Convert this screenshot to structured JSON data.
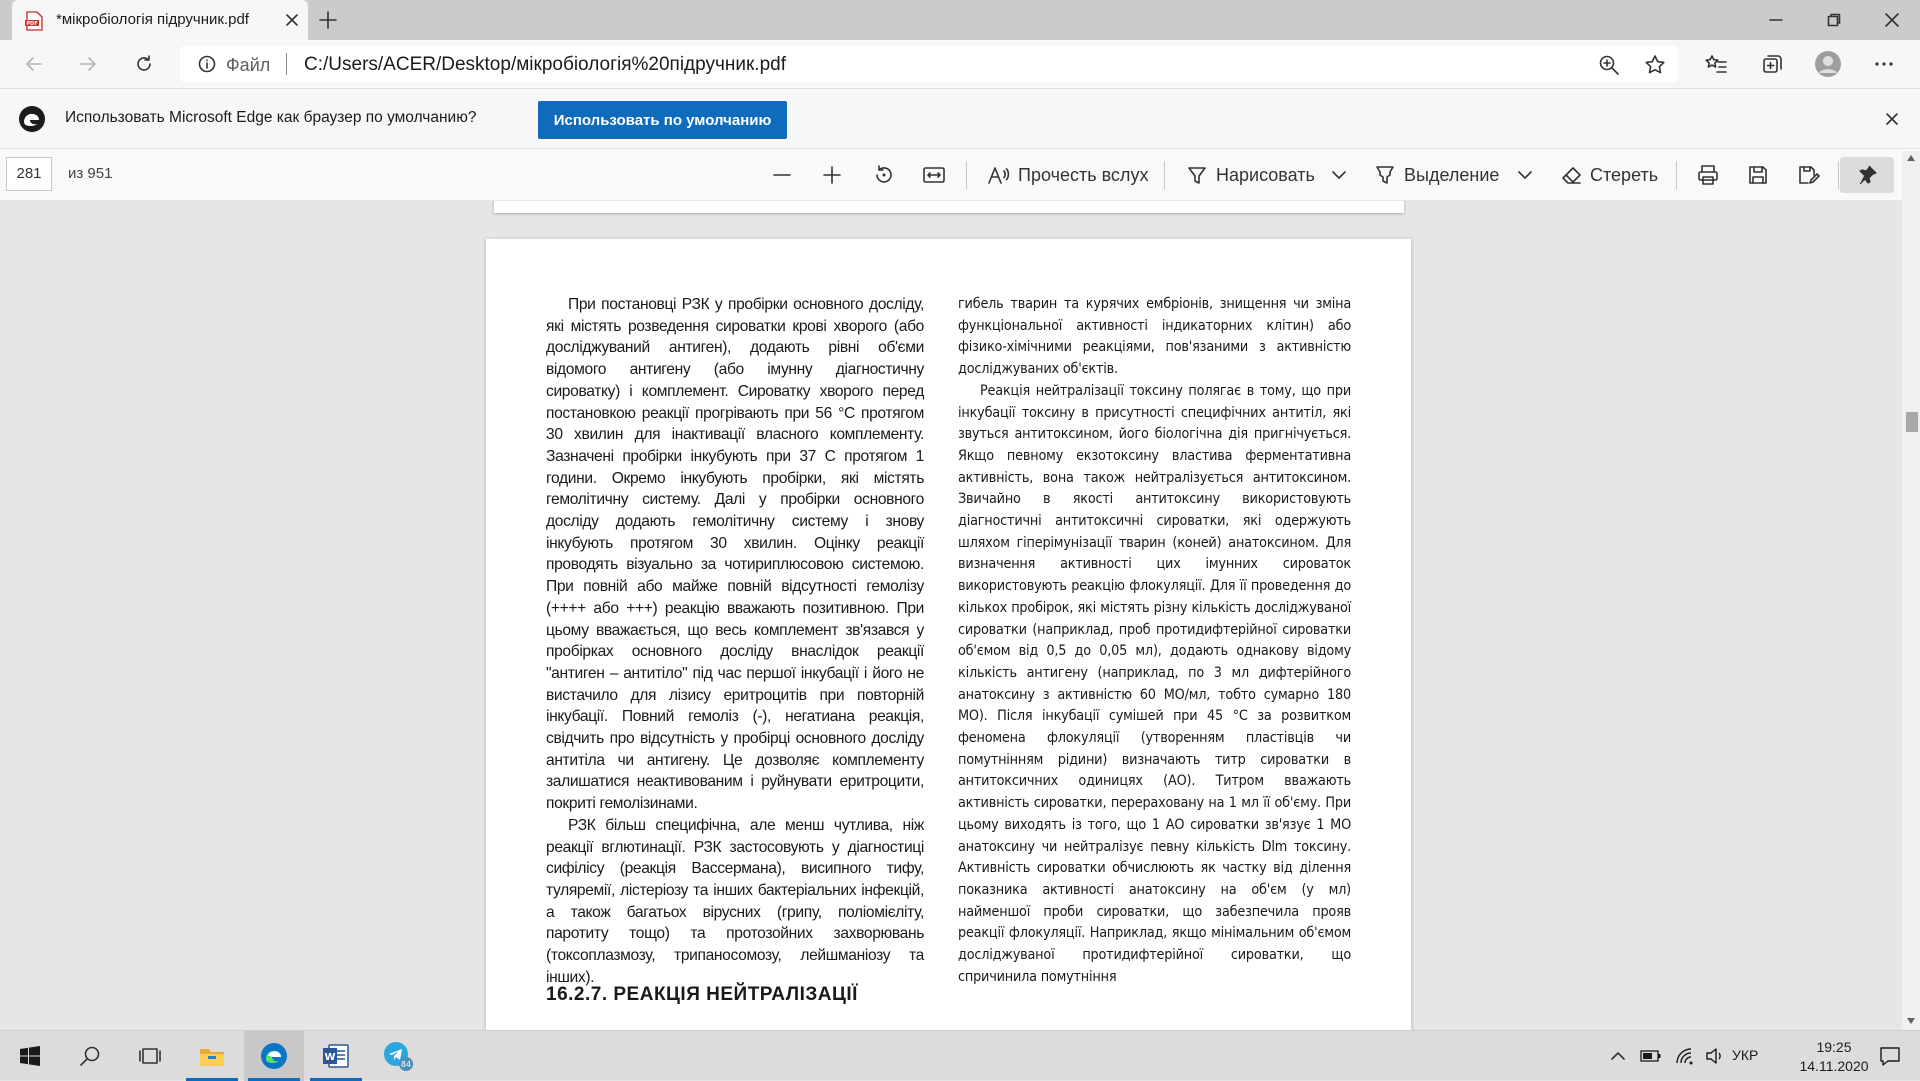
{
  "tab": {
    "title": "*мікробіологія підручник.pdf",
    "icon": "pdf-icon"
  },
  "address": {
    "file_label": "Файл",
    "url": "C:/Users/ACER/Desktop/мікробіологія%20підручник.pdf"
  },
  "infobar": {
    "message": "Использовать Microsoft Edge как браузер по умолчанию?",
    "button_label": "Использовать по умолчанию"
  },
  "pdf_toolbar": {
    "page_number": "281",
    "page_total": "из 951",
    "read_aloud": "Прочесть вслух",
    "draw": "Нарисовать",
    "highlight": "Выделение",
    "erase": "Стереть"
  },
  "document": {
    "left_col": [
      "При постановці РЗК у пробірки основного досліду, які містять розведення сироватки крові хворого (або досліджуваний антиген), додають рівні об'єми відомого антигену (або імунну діагностичну сироватку) і комплемент. Сироватку хворого перед постановкою реакції прогрівають при 56 °С протягом 30 хвилин для інактивації власного комплементу. Зазначені пробірки інкубують при 37 С протягом 1 години. Окремо інкубують пробірки, які містять гемолітичну систему. Далі у пробірки основного досліду додають гемолітичну систему і знову інкубують протягом 30 хвилин. Оцінку реакції проводять візуально за чотириплюсовою системою. При повній або майже повній відсутності гемолізу (++++ або +++) реакцію вважають позитивною. При цьому вважається, що весь комплемент зв'язався у пробірках основного досліду внаслідок реакції \"антиген – антитіло\" під час першої інкубації і його не вистачило для лізису еритроцитів при повторній інкубації. Повний гемоліз (-), негатиана реакція, свідчить про відсутність у пробірці основного досліду антитіла чи антигену. Це дозволяє комплементу залишатися неактивованим і руйнувати еритроцити, покриті гемолізинами.",
      "РЗК більш специфічна, але менш чутлива, ніж реакції вглютинації. РЗК застосовують у діагностиці сифілісу (реакція Вассермана), висипного тифу, туляремії, лістеріозу та інших бактеріальних інфекцій, а також багатьох вірусних (грипу, поліомієліту, паротиту тощо) та протозойних захворювань (токсоплазмозу, трипаносомозу, лейшманіозу та інших)."
    ],
    "section_heading": "16.2.7. РЕАКЦІЯ НЕЙТРАЛІЗАЦІЇ",
    "right_col": [
      "гибель тварин та курячих ембріонів, знищення чи зміна функціональної активності індикаторних клітин) або фізико-хімічними реакціями, пов'язаними з активністю досліджуваних об'єктів.",
      "Реакція нейтралізації токсину полягає в тому, що при інкубації токсину в присутності специфічних антитіл, які звуться антитоксином, його біологічна дія пригнічується. Якщо певному екзотоксину властива ферментативна активність, вона також нейтралізується антитоксином. Звичайно в якості антитоксину використовують діагностичні антитоксичні сироватки, які одержують шляхом гіперімунізації тварин (коней) анатоксином. Для визначення активності цих імунних сироваток використовують реакцію флокуляції. Для її проведення до кількох пробірок, які містять різну кількість досліджуваної сироватки (наприклад, проб протидифтерійної сироватки об'ємом від 0,5 до 0,05 мл), додають однакову відому кількість антигену (наприклад, по 3 мл дифтерійного анатоксину з активністю 60 МО/мл, тобто сумарно 180 МО). Після інкубації сумішей при 45 °С за розвитком феномена флокуляції (утворенням пластівців чи помутнінням рідини) визначають титр сироватки в антитоксичних одиницях (АО). Титром вважають активність сироватки, перераховану на 1 мл її об'єму. При цьому виходять із того, що 1 АО сироватки зв'язує 1 МО анатоксину чи нейтралізує певну кількість Dlm токсину. Активність сироватки обчислюють як частку від ділення показника активності анатоксину на об'єм (у мл) найменшої проби сироватки, що забезпечила прояв реакції флокуляції. Наприклад, якщо мінімальним об'ємом досліджуваної протидифтерійної сироватки, що спричинила помутніння"
    ]
  },
  "taskbar": {
    "apps": [
      "windows-start",
      "search",
      "task-view",
      "file-explorer",
      "edge",
      "word",
      "telegram"
    ],
    "telegram_badge": "84",
    "language": "УКР",
    "time": "19:25",
    "date": "14.11.2020"
  },
  "colors": {
    "accent": "#0f6cbd",
    "tabbar": "#cbcbcb",
    "viewer_bg": "#e6e6e6"
  }
}
